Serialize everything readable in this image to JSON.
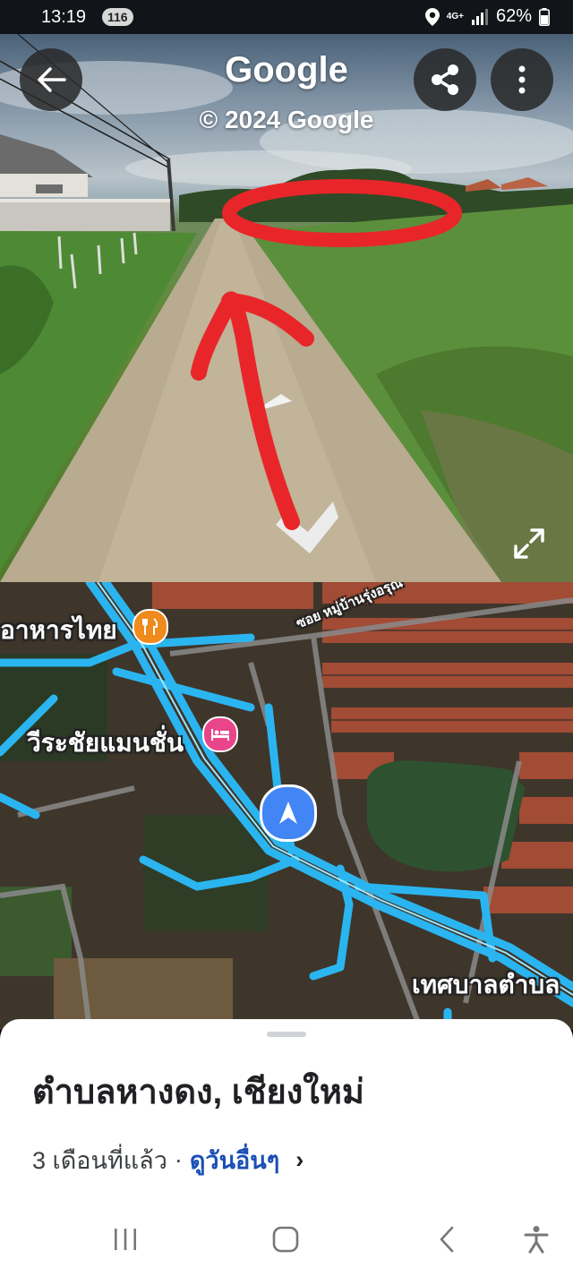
{
  "status_bar": {
    "time": "13:19",
    "notification_count": "116",
    "network": "4G+",
    "battery": "62%"
  },
  "street_view": {
    "brand": "Google",
    "copyright": "© 2024 Google",
    "icons": {
      "back": "arrow-left-icon",
      "share": "share-icon",
      "more": "more-vertical-icon",
      "expand": "expand-icon"
    },
    "annotation_color": "#e8262a"
  },
  "map": {
    "labels": {
      "restaurant": "อาหารไทย",
      "mansion": "วีระชัยแมนชั่น",
      "municipality": "เทศบาลตำบล",
      "soi": "ซอย หมู่บ้านรุ่งอรุณ"
    },
    "route_color": "#2bb5f0",
    "icons": {
      "restaurant": "fork-knife-icon",
      "hotel": "bed-icon",
      "location": "navigation-arrow-icon"
    }
  },
  "sheet": {
    "title": "ตำบลหางดง, เชียงใหม่",
    "date": "3 เดือนที่แล้ว",
    "separator": "·",
    "see_more": "ดูวันอื่นๆ",
    "chevron": "›"
  },
  "nav_bar": {
    "icons": [
      "recents-icon",
      "home-icon",
      "back-icon",
      "accessibility-icon"
    ]
  }
}
